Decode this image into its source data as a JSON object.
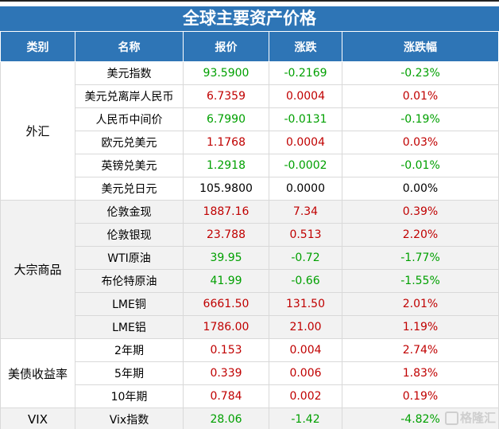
{
  "title": "全球主要资产价格",
  "headers": [
    "类别",
    "名称",
    "报价",
    "涨跌",
    "涨跌幅"
  ],
  "groups": [
    {
      "name": "外汇",
      "rows": [
        [
          "美元指数",
          "93.5900",
          "-0.2169",
          "-0.23%",
          "dn"
        ],
        [
          "美元兑离岸人民币",
          "6.7359",
          "0.0004",
          "0.01%",
          "up"
        ],
        [
          "人民币中间价",
          "6.7990",
          "-0.0131",
          "-0.19%",
          "dn"
        ],
        [
          "欧元兑美元",
          "1.1768",
          "0.0004",
          "0.03%",
          "up"
        ],
        [
          "英镑兑美元",
          "1.2918",
          "-0.0002",
          "-0.01%",
          "dn"
        ],
        [
          "美元兑日元",
          "105.9800",
          "0.0000",
          "0.00%",
          "fl"
        ]
      ]
    },
    {
      "name": "大宗商品",
      "rows": [
        [
          "伦敦金现",
          "1887.16",
          "7.34",
          "0.39%",
          "up"
        ],
        [
          "伦敦银现",
          "23.788",
          "0.513",
          "2.20%",
          "up"
        ],
        [
          "WTI原油",
          "39.95",
          "-0.72",
          "-1.77%",
          "dn"
        ],
        [
          "布伦特原油",
          "41.99",
          "-0.66",
          "-1.55%",
          "dn"
        ],
        [
          "LME铜",
          "6661.50",
          "131.50",
          "2.01%",
          "up"
        ],
        [
          "LME铝",
          "1786.00",
          "21.00",
          "1.19%",
          "up"
        ]
      ]
    },
    {
      "name": "美债收益率",
      "rows": [
        [
          "2年期",
          "0.153",
          "0.004",
          "2.74%",
          "up"
        ],
        [
          "5年期",
          "0.339",
          "0.006",
          "1.83%",
          "up"
        ],
        [
          "10年期",
          "0.784",
          "0.002",
          "0.19%",
          "up"
        ]
      ]
    },
    {
      "name": "VIX",
      "rows": [
        [
          "Vix指数",
          "28.06",
          "-1.42",
          "-4.82%",
          "dn"
        ]
      ]
    }
  ],
  "watermark": "格隆汇"
}
